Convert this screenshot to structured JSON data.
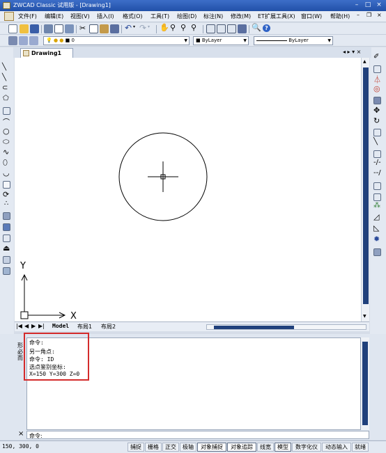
{
  "window": {
    "title": "ZWCAD Classic 试用版 - [Drawing1]",
    "min": "–",
    "max": "□",
    "close": "×"
  },
  "menu": {
    "items": [
      "文件(F)",
      "编辑(E)",
      "视图(V)",
      "插入(I)",
      "格式(O)",
      "工具(T)",
      "绘图(D)",
      "标注(N)",
      "修改(M)",
      "ET扩展工具(X)",
      "窗口(W)",
      "帮助(H)"
    ],
    "doc_min": "–",
    "doc_restore": "❐",
    "doc_close": "×"
  },
  "toolbar": {
    "layer_value": "0",
    "color_value": "ByLayer",
    "linetype_value": "ByLayer"
  },
  "document": {
    "tab_label": "Drawing1",
    "tab_nav": "◂ ▸ ▾ ×"
  },
  "ucs": {
    "x_label": "X",
    "y_label": "Y"
  },
  "layout": {
    "tabs": [
      "Model",
      "布局1",
      "布局2"
    ],
    "nav": [
      "|◀",
      "◀",
      "▶",
      "▶|"
    ]
  },
  "command": {
    "history_left": [
      "形",
      "必",
      "而"
    ],
    "lines": [
      "命令:",
      "另一角点:",
      "命令: ID",
      "选点鉴别坐标:",
      "X=150  Y=300  Z=0"
    ],
    "prompt": "命令:",
    "close": "×"
  },
  "status": {
    "coords": "150, 300, 0",
    "buttons": [
      {
        "label": "捕捉",
        "on": false
      },
      {
        "label": "栅格",
        "on": false
      },
      {
        "label": "正交",
        "on": false
      },
      {
        "label": "极轴",
        "on": false
      },
      {
        "label": "对象捕捉",
        "on": true
      },
      {
        "label": "对象追踪",
        "on": true
      },
      {
        "label": "线宽",
        "on": false
      },
      {
        "label": "模型",
        "on": true
      },
      {
        "label": "数字化仪",
        "on": false
      },
      {
        "label": "动态输入",
        "on": false
      },
      {
        "label": "就绪",
        "on": false
      }
    ]
  },
  "colors": {
    "accent": "#21417c",
    "highlight_box": "#d42b2b",
    "title_bar": "#2150a8"
  }
}
